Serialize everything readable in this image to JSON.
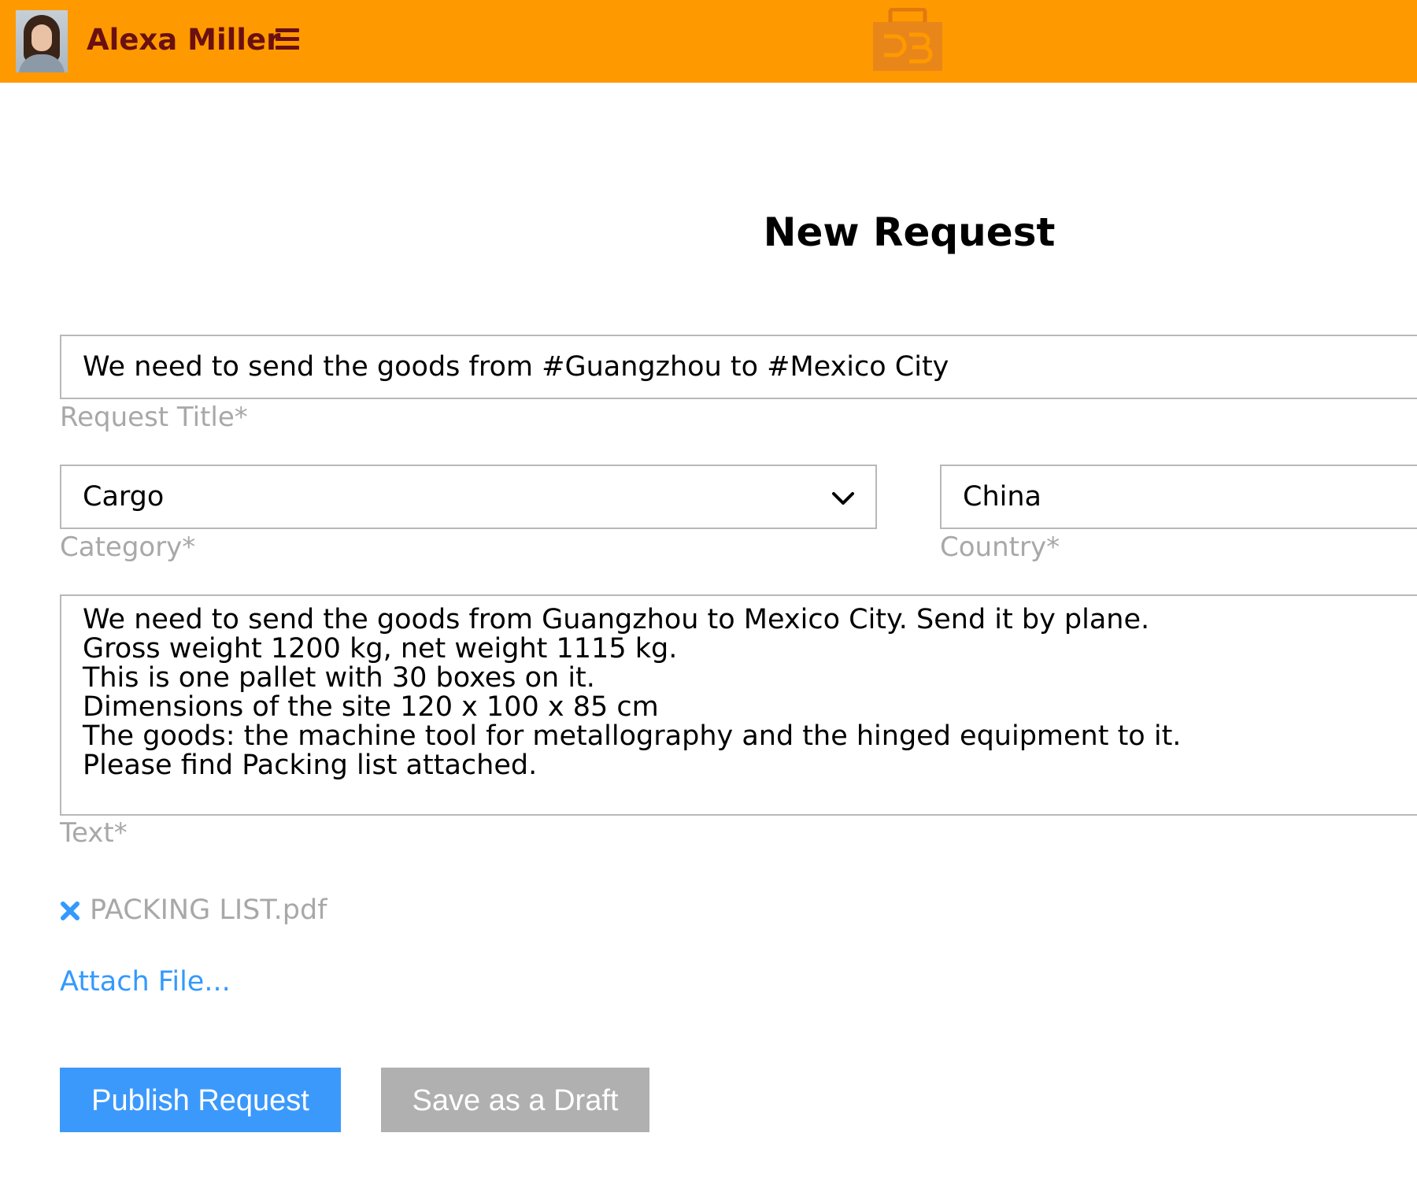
{
  "header": {
    "user_name": "Alexa Miller",
    "logo_text": "DB",
    "background_color": "#ff9900",
    "text_color": "#6b1010"
  },
  "page": {
    "title": "New Request"
  },
  "form": {
    "request_title": {
      "value": "We need to send the goods from #Guangzhou to #Mexico City",
      "label": "Request Title*"
    },
    "category": {
      "value": "Cargo",
      "label": "Category*",
      "icon": "chevron-down-icon"
    },
    "country": {
      "value": "China",
      "label": "Country*"
    },
    "text": {
      "value": "We need to send the goods from Guangzhou to Mexico City. Send it by plane.\nGross weight 1200 kg, net weight 1115 kg.\nThis is one pallet with 30 boxes on it.\nDimensions of the site 120 x 100 x 85 cm\nThe goods: the machine tool for metallography and the hinged equipment to it.\nPlease find Packing list attached.",
      "label": "Text*"
    }
  },
  "attachments": [
    {
      "name": "PACKING LIST.pdf",
      "remove_icon": "close-icon"
    }
  ],
  "attach_link": "Attach File...",
  "buttons": {
    "publish": "Publish Request",
    "draft": "Save as a Draft"
  },
  "colors": {
    "accent": "#3b99fc",
    "link": "#3399ff",
    "muted": "#a8a8a8",
    "draft_button": "#b0b0b0"
  }
}
